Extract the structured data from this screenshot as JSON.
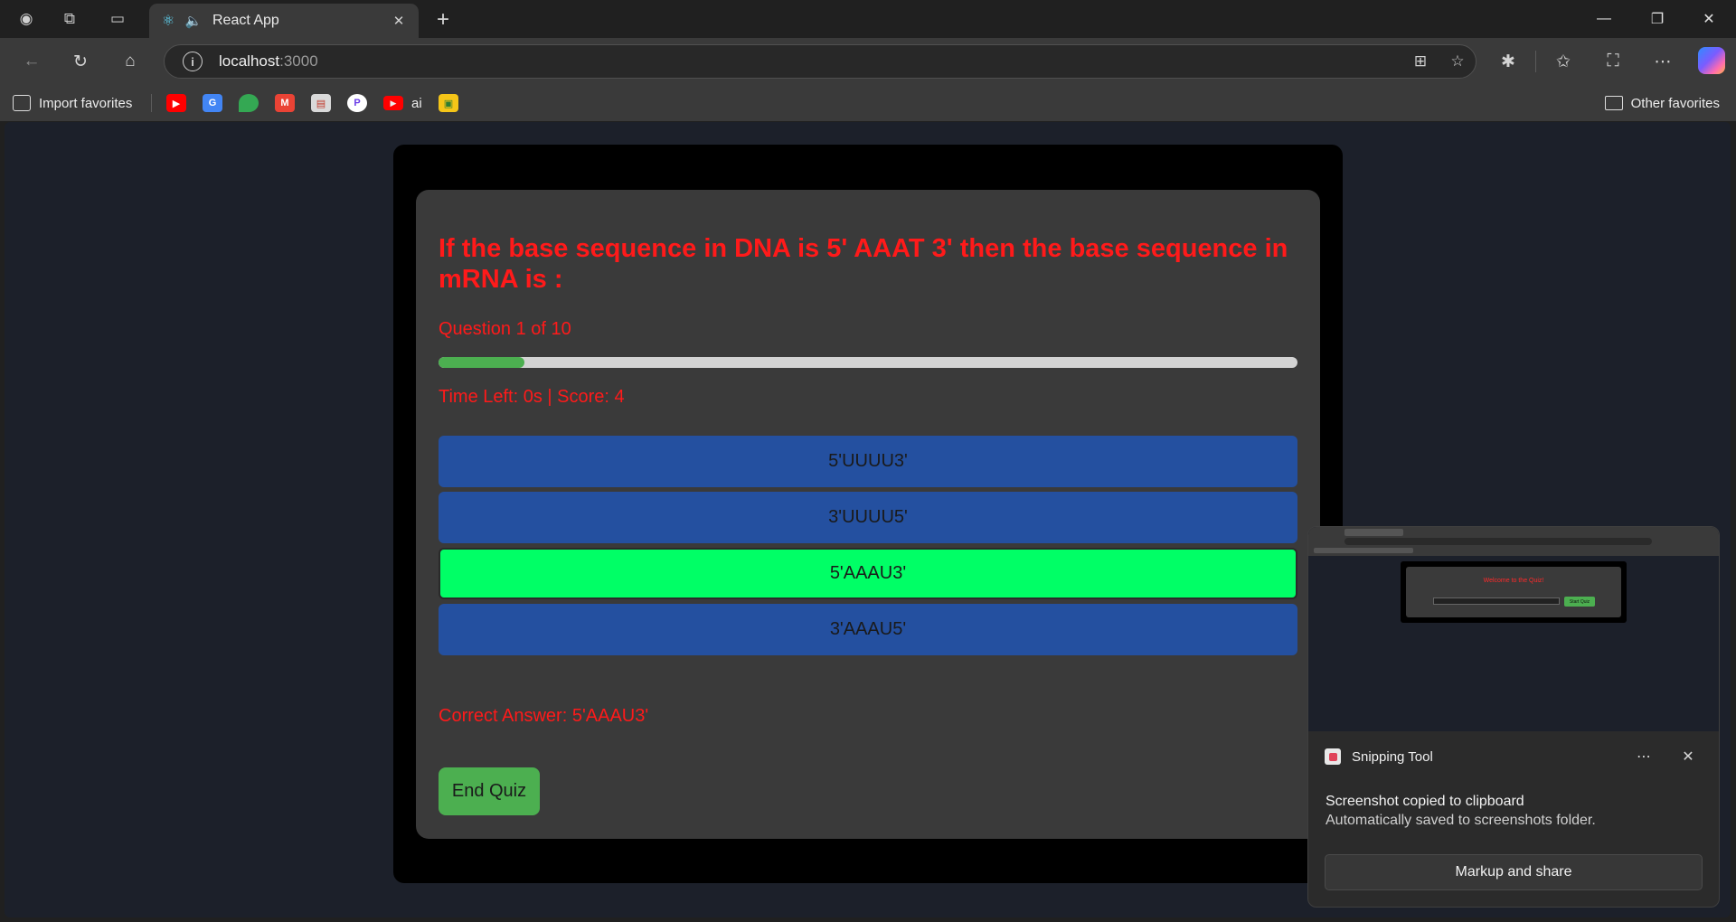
{
  "browser": {
    "tab_title": "React App",
    "url_host": "localhost",
    "url_port": ":3000",
    "favorites": {
      "import_label": "Import favorites",
      "ai_label": "ai",
      "other_label": "Other favorites"
    }
  },
  "quiz": {
    "question": "If the base sequence in DNA is 5' AAAT 3' then the base sequence in mRNA is :",
    "counter": "Question 1 of 10",
    "progress_fraction": 0.1,
    "status": "Time Left: 0s | Score: 4",
    "options": [
      "5'UUUU3'",
      "3'UUUU5'",
      "5'AAAU3'",
      "3'AAAU5'"
    ],
    "highlighted_option": 2,
    "correct_answer": "Correct Answer: 5'AAAU3'",
    "end_button": "End Quiz",
    "colors": {
      "text_red": "#ff1a1a",
      "option_blue": "#2450a0",
      "option_correct": "#00ff66",
      "progress": "#4caf50"
    }
  },
  "toast": {
    "app_name": "Snipping Tool",
    "message_title": "Screenshot copied to clipboard",
    "message_body": "Automatically saved to screenshots folder.",
    "action_label": "Markup and share",
    "thumbnail_title": "Welcome to the Quiz!",
    "thumbnail_button": "Start Quiz"
  }
}
